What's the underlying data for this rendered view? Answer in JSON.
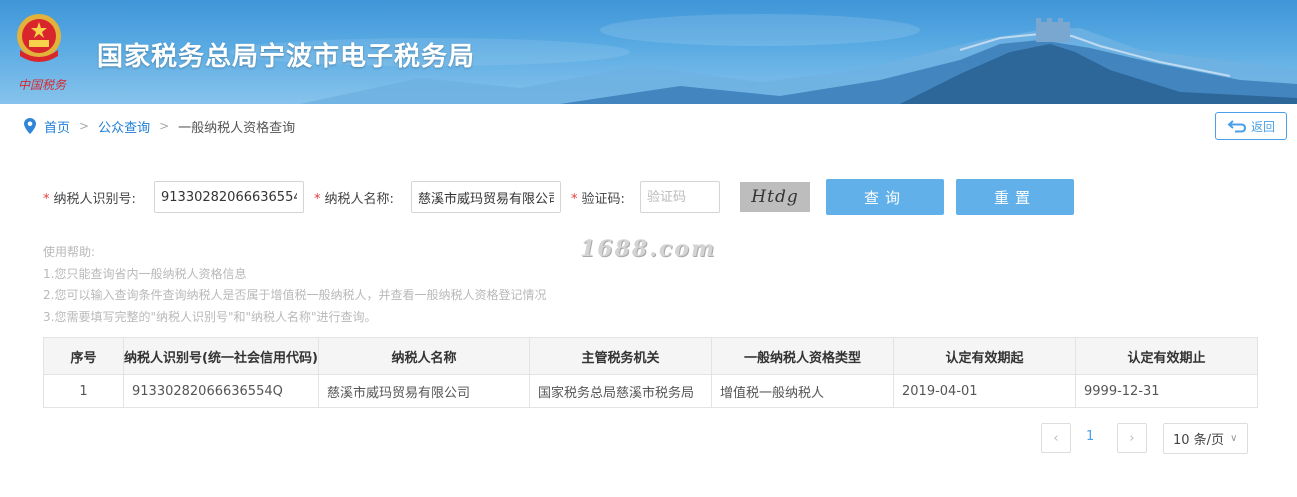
{
  "header": {
    "site_title": "国家税务总局宁波市电子税务局",
    "brand_script": "中国税务",
    "colors": {
      "banner": "#4a9ddc",
      "brand_red": "#d9262c"
    }
  },
  "breadcrumb": {
    "home": "首页",
    "level2": "公众查询",
    "current": "一般纳税人资格查询",
    "back_label": "返回"
  },
  "form": {
    "taxpayer_id_label": "纳税人识别号:",
    "taxpayer_id_value": "91330282066636554Q",
    "taxpayer_name_label": "纳税人名称:",
    "taxpayer_name_value": "慈溪市威玛贸易有限公司",
    "captcha_label": "验证码:",
    "captcha_placeholder": "验证码",
    "captcha_text": "Htdg",
    "query_button": "查询",
    "reset_button": "重置",
    "required_mark": "*"
  },
  "help": {
    "title": "使用帮助:",
    "lines": [
      "1.您只能查询省内一般纳税人资格信息",
      "2.您可以输入查询条件查询纳税人是否属于增值税一般纳税人，并查看一般纳税人资格登记情况",
      "3.您需要填写完整的\"纳税人识别号\"和\"纳税人名称\"进行查询。"
    ]
  },
  "watermark": "1688.com",
  "table": {
    "headers": [
      "序号",
      "纳税人识别号(统一社会信用代码)",
      "纳税人名称",
      "主管税务机关",
      "一般纳税人资格类型",
      "认定有效期起",
      "认定有效期止"
    ],
    "rows": [
      [
        "1",
        "91330282066636554Q",
        "慈溪市威玛贸易有限公司",
        "国家税务总局慈溪市税务局",
        "增值税一般纳税人",
        "2019-04-01",
        "9999-12-31"
      ]
    ]
  },
  "pager": {
    "prev": "‹",
    "current_page": "1",
    "next": "›",
    "page_size": "10 条/页"
  }
}
